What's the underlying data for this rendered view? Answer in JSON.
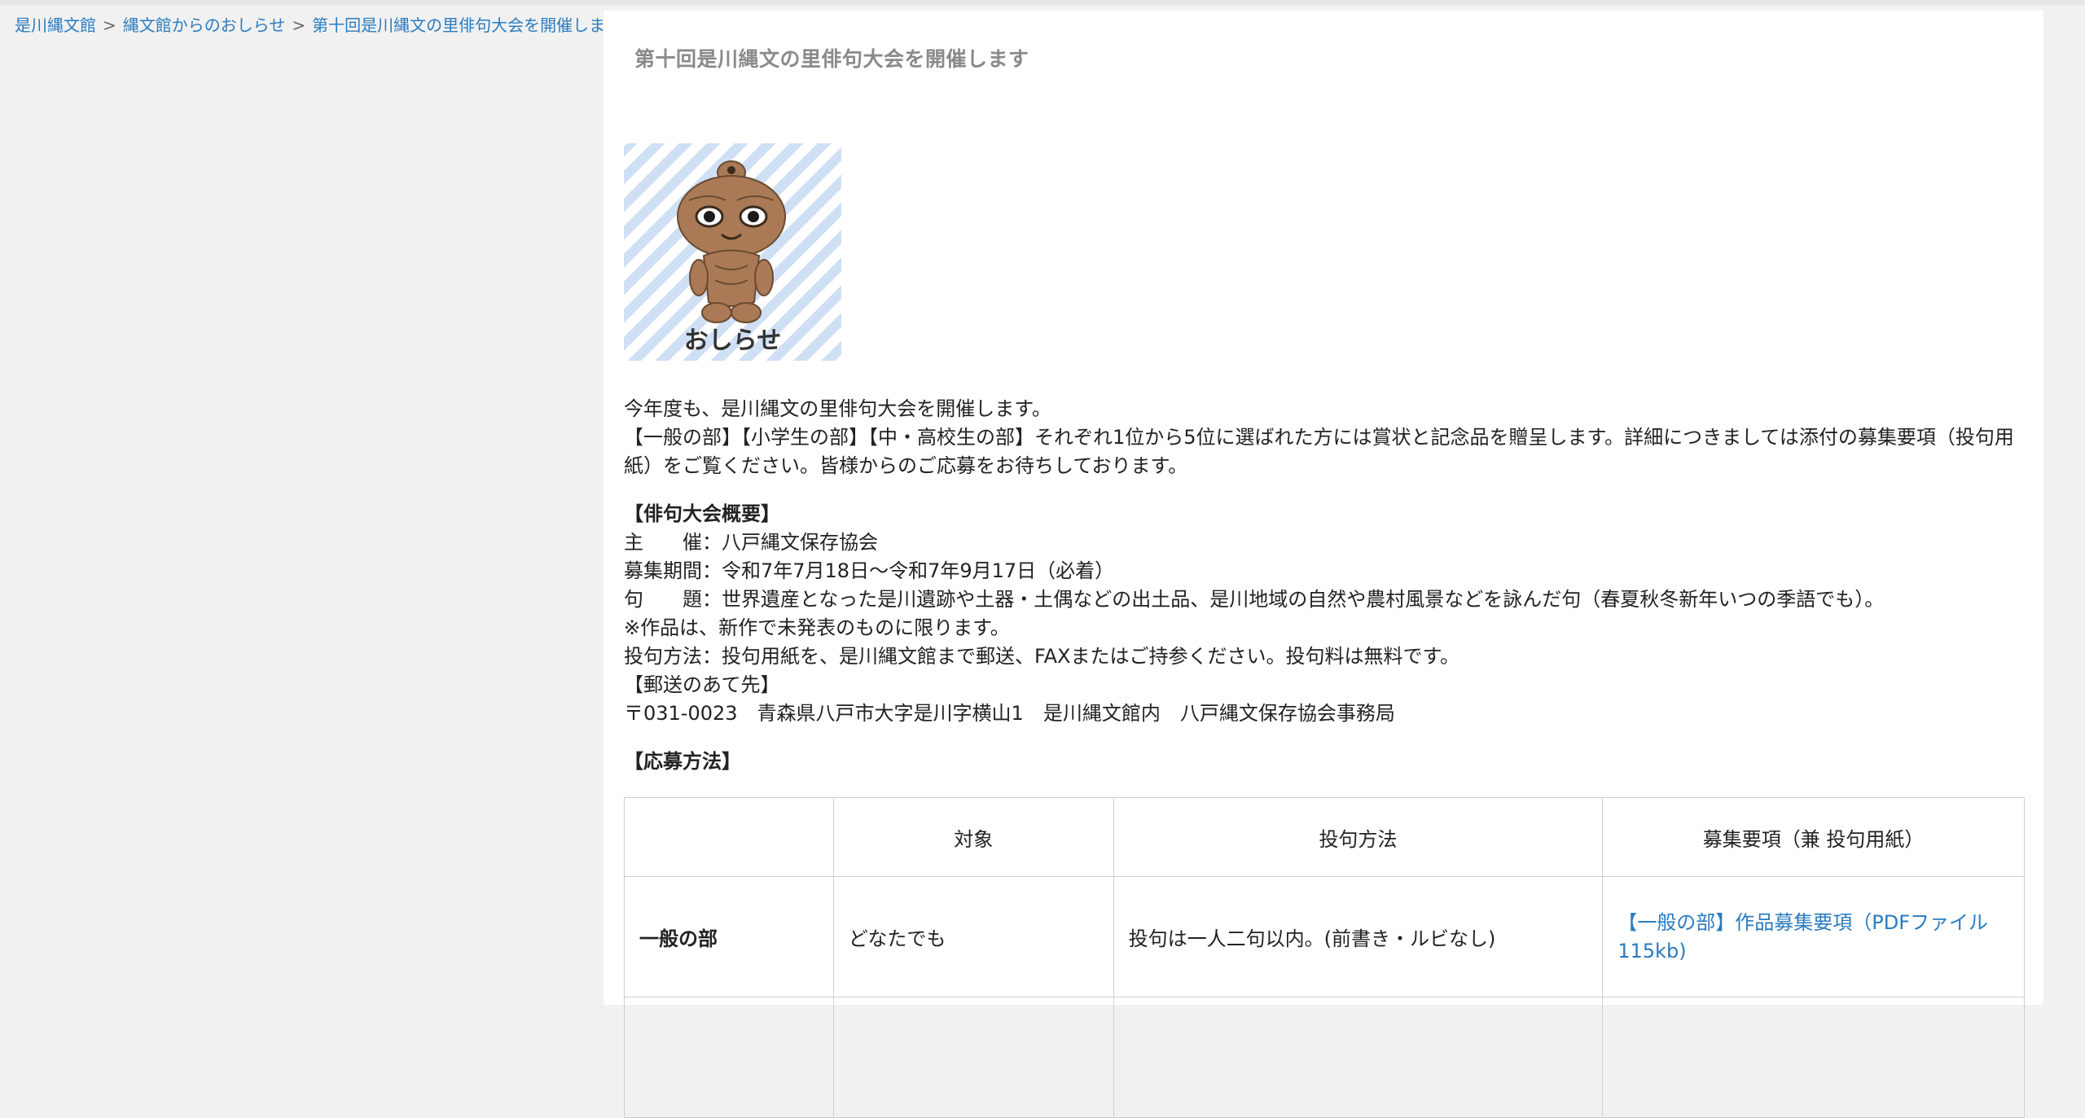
{
  "breadcrumb": {
    "items": [
      "是川縄文館",
      "縄文館からのおしらせ",
      "第十回是川縄文の里俳句大会を開催します"
    ],
    "separator": ">"
  },
  "page": {
    "title": "第十回是川縄文の里俳句大会を開催します"
  },
  "image": {
    "label": "おしらせ",
    "icon": "dogu-mascot-icon"
  },
  "intro": {
    "line1": "今年度も、是川縄文の里俳句大会を開催します。",
    "line2": "【一般の部】【小学生の部】【中・高校生の部】それぞれ1位から5位に選ばれた方には賞状と記念品を贈呈します。詳細につきましては添付の募集要項（投句用紙）をご覧ください。皆様からのご応募をお待ちしております。"
  },
  "summary": {
    "heading": "【俳句大会概要】",
    "organizer": "主　　催：八戸縄文保存協会",
    "period": "募集期間：令和7年7月18日～令和7年9月17日（必着）",
    "theme": "句　　題：世界遺産となった是川遺跡や土器・土偶などの出土品、是川地域の自然や農村風景などを詠んだ句（春夏秋冬新年いつの季語でも）。",
    "note": "※作品は、新作で未発表のものに限ります。",
    "method": "投句方法：投句用紙を、是川縄文館まで郵送、FAXまたはご持参ください。投句料は無料です。",
    "mail_heading": "【郵送のあて先】",
    "address": "〒031-0023　青森県八戸市大字是川字横山1　是川縄文館内　八戸縄文保存協会事務局"
  },
  "apply": {
    "heading": "【応募方法】",
    "columns": [
      "",
      "対象",
      "投句方法",
      "募集要項（兼 投句用紙）"
    ],
    "rows": [
      {
        "category": "一般の部",
        "target": "どなたでも",
        "method": "投句は一人二句以内。(前書き・ルビなし)",
        "link": "【一般の部】作品募集要項（PDFファイル115kb)"
      }
    ]
  },
  "colors": {
    "link": "#2a7bbf",
    "title_gray": "#8a8a8a",
    "page_bg": "#f1f1f1",
    "content_bg": "#ffffff",
    "stripe_blue": "#cfe0f5"
  }
}
